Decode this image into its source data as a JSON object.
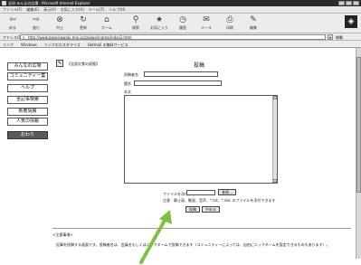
{
  "window": {
    "title": "全研 みんなの広場 - Microsoft Internet Explorer"
  },
  "menu": [
    "ファイル(F)",
    "編集(E)",
    "表示(V)",
    "お気に入り(A)",
    "ツール(T)",
    "ヘルプ(H)"
  ],
  "toolbar": [
    {
      "label": "戻る",
      "icon": "back-icon"
    },
    {
      "label": "進む",
      "icon": "forward-icon"
    },
    {
      "label": "中止",
      "icon": "stop-icon"
    },
    {
      "label": "更新",
      "icon": "refresh-icon"
    },
    {
      "label": "ホーム",
      "icon": "home-icon"
    },
    {
      "label": "検索",
      "icon": "search-icon"
    },
    {
      "label": "お気に入り",
      "icon": "favorites-icon"
    },
    {
      "label": "履歴",
      "icon": "history-icon"
    },
    {
      "label": "メール",
      "icon": "mail-icon"
    },
    {
      "label": "印刷",
      "icon": "print-icon"
    },
    {
      "label": "編集",
      "icon": "edit-icon"
    }
  ],
  "address": {
    "label": "アドレス(D)",
    "value": "http://www.baseisawaki.mie.jp/zasiwei/noma/indxs2.html",
    "go_label": "移動"
  },
  "links": [
    "リンク",
    "Windows",
    "リンクのカスタマイズ",
    "Hotmail の無料サービス"
  ],
  "nav": [
    "みんなの広場",
    "コミュニティー集",
    "ヘルプ",
    "全記事検索",
    "新着情報",
    "人気の情報",
    "おわり"
  ],
  "form": {
    "section_label": "【全部欠食の部屋】",
    "title": "投稿",
    "poster_label": "投稿者名",
    "subject_label": "題名",
    "body_label": "本文",
    "attach_label": "ファイルを添付する",
    "browse_label": "参照...",
    "attach_note": "注意：静止画、動画、音声、*.txt、*.doc のファイルを添付できます",
    "submit_label": "投稿",
    "cancel_label": "やめる"
  },
  "notice": {
    "heading": "<注意事項>",
    "text": "記事を投稿する画面です。投稿者名は、会員名もしくはニックネームで投稿できます（コミュニティーによっては、自由にニックネームを設定できるものもあります）。"
  },
  "colors": {
    "titlebar": "#2b2b2b",
    "arrow": "#7cc23f"
  }
}
